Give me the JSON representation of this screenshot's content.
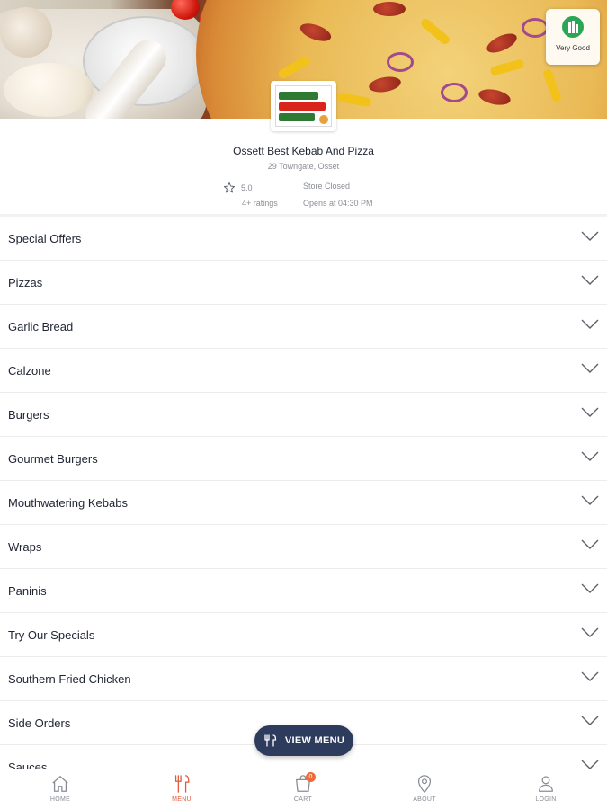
{
  "hero": {
    "rating_chip_label": "Very Good"
  },
  "store": {
    "name": "Ossett Best Kebab And Pizza",
    "address": "29 Towngate, Osset",
    "rating": "5.0",
    "ratings_count": "4+ ratings",
    "status": "Store Closed",
    "opens": "Opens at 04:30 PM"
  },
  "menu": {
    "categories": [
      "Special Offers",
      "Pizzas",
      "Garlic Bread",
      "Calzone",
      "Burgers",
      "Gourmet Burgers",
      "Mouthwatering Kebabs",
      "Wraps",
      "Paninis",
      "Try Our Specials",
      "Southern Fried Chicken",
      "Side Orders",
      "Sauces"
    ]
  },
  "floating_button": {
    "label": "VIEW MENU",
    "icon": "cutlery-icon"
  },
  "bottom_nav": {
    "items": [
      {
        "label": "HOME",
        "icon": "home-icon",
        "active": false
      },
      {
        "label": "MENU",
        "icon": "cutlery-icon",
        "active": true
      },
      {
        "label": "CART",
        "icon": "cart-icon",
        "active": false,
        "badge": "0"
      },
      {
        "label": "ABOUT",
        "icon": "location-pin-icon",
        "active": false
      },
      {
        "label": "LOGIN",
        "icon": "user-icon",
        "active": false
      }
    ]
  },
  "colors": {
    "accent": "#e05a3a",
    "button_bg": "#2d3b5c",
    "text_primary": "#1f2433",
    "text_muted": "#8a8d96",
    "divider": "#ececec"
  }
}
